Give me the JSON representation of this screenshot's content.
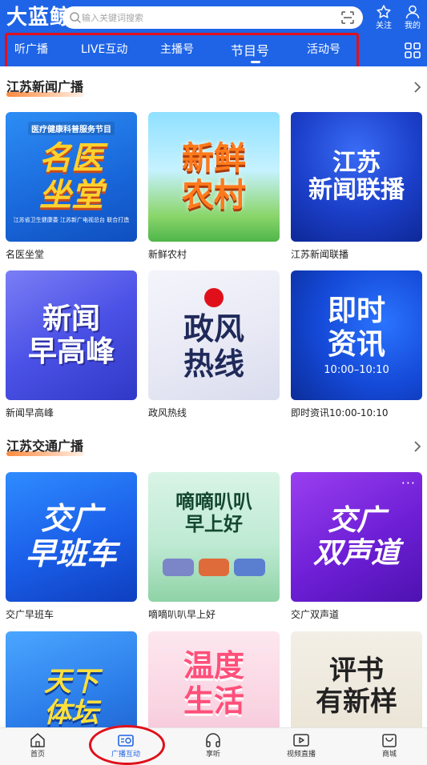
{
  "header": {
    "logo": "大蓝鲸",
    "search_placeholder": "输入关键词搜索",
    "follow_label": "关注",
    "mine_label": "我的"
  },
  "tabs": [
    {
      "label": "听广播"
    },
    {
      "label": "LIVE互动"
    },
    {
      "label": "主播号"
    },
    {
      "label": "节目号",
      "active": true
    },
    {
      "label": "活动号"
    }
  ],
  "sections": [
    {
      "title": "江苏新闻广播",
      "cards": [
        {
          "title": "名医坐堂",
          "art_top": "医疗健康科普服务节目",
          "art_l1": "名医",
          "art_l2": "坐堂",
          "art_foot": "江苏省卫生健康委 江苏新广电视总台 联合打造"
        },
        {
          "title": "新鲜农村",
          "art_l1": "新鲜",
          "art_l2": "农村"
        },
        {
          "title": "江苏新闻联播",
          "art_l1": "江苏",
          "art_l2": "新闻联播"
        },
        {
          "title": "新闻早高峰",
          "art_l1": "新闻",
          "art_l2": "早高峰"
        },
        {
          "title": "政风热线",
          "art_l1": "政风",
          "art_l2": "热线"
        },
        {
          "title": "即时资讯10:00-10:10",
          "art_l1": "即时",
          "art_l2": "资讯",
          "art_sub": "10:00–10:10"
        }
      ]
    },
    {
      "title": "江苏交通广播",
      "cards": [
        {
          "title": "交广早班车",
          "art_l1": "交广",
          "art_l2": "早班车"
        },
        {
          "title": "嘀嘀叭叭早上好",
          "art_l1": "嘀嘀叭叭",
          "art_l2": "早上好"
        },
        {
          "title": "交广双声道",
          "art_l1": "交广",
          "art_l2": "双声道"
        },
        {
          "title": "",
          "art_l1": "天下",
          "art_l2": "体坛"
        },
        {
          "title": "",
          "art_l1": "温度",
          "art_l2": "生活"
        },
        {
          "title": "",
          "art_l1": "评书",
          "art_l2": "有新样"
        }
      ]
    }
  ],
  "bottom_nav": [
    {
      "label": "首页",
      "icon": "home-icon"
    },
    {
      "label": "广播互动",
      "icon": "radio-icon",
      "active": true
    },
    {
      "label": "享听",
      "icon": "headphones-icon"
    },
    {
      "label": "视频直播",
      "icon": "video-icon"
    },
    {
      "label": "商城",
      "icon": "shop-icon"
    }
  ],
  "colors": {
    "brand_blue": "#1f64e6",
    "accent_orange": "#ff8a3d",
    "annotation_red": "#e0101a"
  }
}
